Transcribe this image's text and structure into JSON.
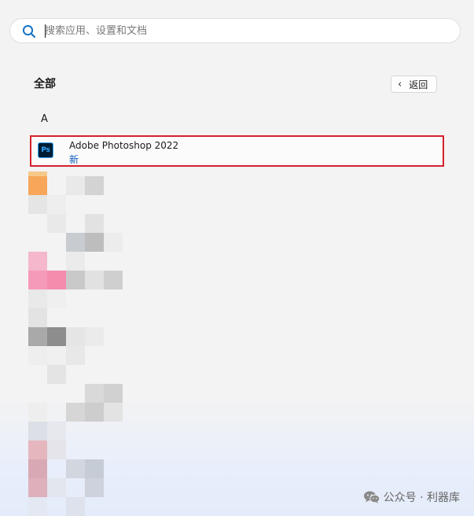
{
  "search": {
    "placeholder": "搜索应用、设置和文档",
    "value": ""
  },
  "section": {
    "title": "全部",
    "back_label": "返回"
  },
  "list": {
    "letter": "A",
    "apps": [
      {
        "name": "Adobe Photoshop 2022",
        "badge": "新",
        "icon_text": "Ps",
        "icon": "photoshop-icon"
      }
    ]
  },
  "watermark": {
    "text": "公众号 · 利器库",
    "icon": "wechat-icon"
  },
  "colors": {
    "highlight_border": "#d4212c",
    "badge_new": "#0f5cc0",
    "ps_icon_bg": "#001e36",
    "ps_icon_fg": "#31a8ff"
  },
  "icons": {
    "search": "search-icon",
    "back": "chevron-left-icon"
  }
}
